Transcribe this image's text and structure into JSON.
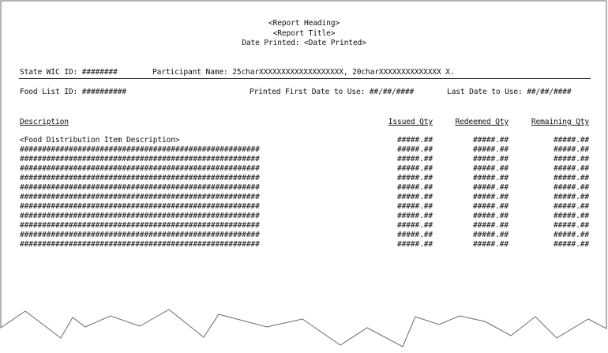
{
  "header": {
    "report_heading": "<Report Heading>",
    "report_title": "<Report Title>",
    "date_printed": "Date Printed: <Date Printed>"
  },
  "participant": {
    "state_wic_id": "State WIC ID: ########",
    "participant_name": "Participant Name: 25charXXXXXXXXXXXXXXXXXXX, 20charXXXXXXXXXXXXXX X."
  },
  "food_list": {
    "food_list_id": "Food List ID: ##########",
    "first_date": "Printed First Date to Use: ##/##/####",
    "last_date": "Last Date to Use: ##/##/####"
  },
  "columns": {
    "description": "Description",
    "issued_qty": "Issued Qty",
    "redeemed_qty": "Redeemed Qty",
    "remaining_qty": "Remaining Qty"
  },
  "rows": [
    {
      "description": "<Food Distribution Item Description>",
      "issued": "#####.##",
      "redeemed": "#####.##",
      "remaining": "#####.##"
    },
    {
      "description": "######################################################",
      "issued": "#####.##",
      "redeemed": "#####.##",
      "remaining": "#####.##"
    },
    {
      "description": "######################################################",
      "issued": "#####.##",
      "redeemed": "#####.##",
      "remaining": "#####.##"
    },
    {
      "description": "######################################################",
      "issued": "#####.##",
      "redeemed": "#####.##",
      "remaining": "#####.##"
    },
    {
      "description": "######################################################",
      "issued": "#####.##",
      "redeemed": "#####.##",
      "remaining": "#####.##"
    },
    {
      "description": "######################################################",
      "issued": "#####.##",
      "redeemed": "#####.##",
      "remaining": "#####.##"
    },
    {
      "description": "######################################################",
      "issued": "#####.##",
      "redeemed": "#####.##",
      "remaining": "#####.##"
    },
    {
      "description": "######################################################",
      "issued": "#####.##",
      "redeemed": "#####.##",
      "remaining": "#####.##"
    },
    {
      "description": "######################################################",
      "issued": "#####.##",
      "redeemed": "#####.##",
      "remaining": "#####.##"
    },
    {
      "description": "######################################################",
      "issued": "#####.##",
      "redeemed": "#####.##",
      "remaining": "#####.##"
    },
    {
      "description": "######################################################",
      "issued": "#####.##",
      "redeemed": "#####.##",
      "remaining": "#####.##"
    },
    {
      "description": "######################################################",
      "issued": "#####.##",
      "redeemed": "#####.##",
      "remaining": "#####.##"
    }
  ]
}
